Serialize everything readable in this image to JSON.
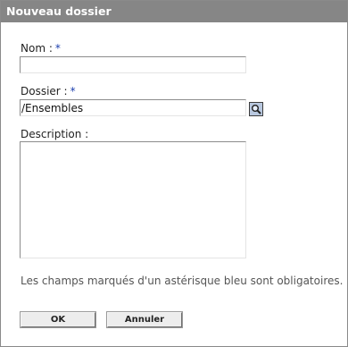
{
  "dialog": {
    "title": "Nouveau dossier"
  },
  "form": {
    "name": {
      "label": "Nom :",
      "required_marker": "*",
      "value": ""
    },
    "folder": {
      "label": "Dossier :",
      "required_marker": "*",
      "value": "/Ensembles",
      "browse_icon": "magnifier-icon"
    },
    "description": {
      "label": "Description :",
      "value": ""
    },
    "required_note": "Les champs marqués d'un astérisque bleu sont obligatoires."
  },
  "buttons": {
    "ok_label": "OK",
    "cancel_label": "Annuler"
  },
  "colors": {
    "titlebar": "#868686",
    "required_marker": "#1c3fae"
  }
}
